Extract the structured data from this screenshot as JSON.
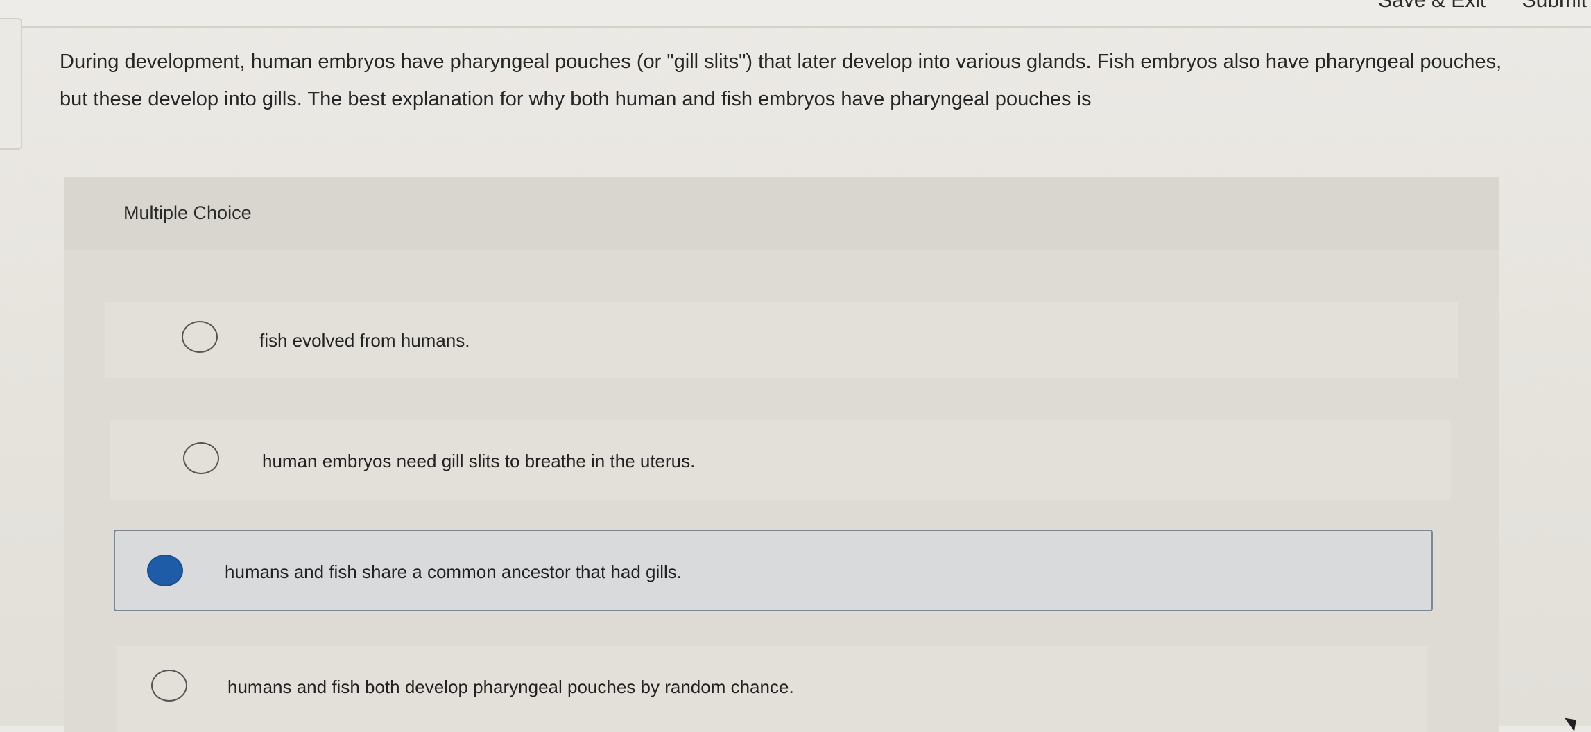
{
  "top_bar": {
    "save_exit_label": "Save & Exit",
    "submit_label": "Submit"
  },
  "question": {
    "text": "During development, human embryos have pharyngeal pouches (or \"gill slits\") that later develop into various glands. Fish embryos also have pharyngeal pouches, but these develop into gills. The best explanation for why both human and fish embryos have pharyngeal pouches is"
  },
  "multiple_choice": {
    "label": "Multiple Choice",
    "options": [
      {
        "text": "fish evolved from humans.",
        "selected": false
      },
      {
        "text": "human embryos need gill slits to breathe in the uterus.",
        "selected": false
      },
      {
        "text": "humans and fish share a common ancestor that had gills.",
        "selected": true
      },
      {
        "text": "humans and fish both develop pharyngeal pouches by random chance.",
        "selected": false
      }
    ]
  },
  "colors": {
    "selected_radio": "#1f5ca8",
    "selected_border": "#7d8896"
  }
}
